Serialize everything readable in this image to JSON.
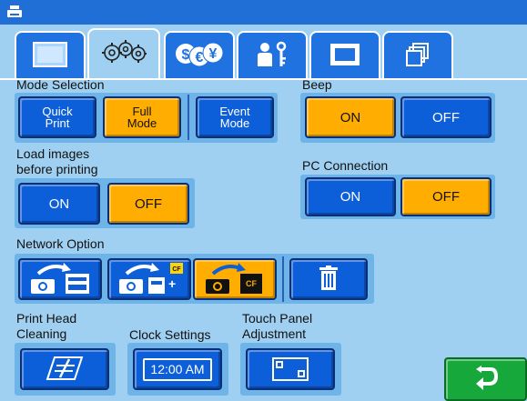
{
  "tabs": [
    {
      "id": "display",
      "icon": "blank-screen-icon",
      "active": false
    },
    {
      "id": "settings",
      "icon": "gears-icon",
      "active": true
    },
    {
      "id": "currency",
      "icon": "currency-icon",
      "active": false
    },
    {
      "id": "security",
      "icon": "person-key-icon",
      "active": false
    },
    {
      "id": "frame",
      "icon": "frame-icon",
      "active": false
    },
    {
      "id": "layers",
      "icon": "layers-icon",
      "active": false
    }
  ],
  "mode_selection": {
    "label": "Mode Selection",
    "quick_print": "Quick\nPrint",
    "full_mode": "Full\nMode",
    "event_mode": "Event\nMode",
    "selected": "full_mode"
  },
  "beep": {
    "label": "Beep",
    "on": "ON",
    "off": "OFF",
    "selected": "on"
  },
  "load_images": {
    "label": "Load images\nbefore printing",
    "on": "ON",
    "off": "OFF",
    "selected": "off"
  },
  "pc_connection": {
    "label": "PC Connection",
    "on": "ON",
    "off": "OFF",
    "selected": "off"
  },
  "network_option": {
    "label": "Network Option",
    "buttons": [
      {
        "name": "camera-to-printer",
        "selected": false
      },
      {
        "name": "camera-to-cf-printer",
        "selected": false
      },
      {
        "name": "camera-to-cf",
        "selected": true,
        "cf_text": "CF"
      },
      {
        "name": "trash",
        "selected": false
      }
    ],
    "cf_badge": "CF"
  },
  "print_head_cleaning": {
    "label": "Print Head\nCleaning"
  },
  "clock_settings": {
    "label": "Clock Settings",
    "time": "12:00 AM"
  },
  "touch_panel": {
    "label": "Touch Panel\nAdjustment"
  },
  "colors": {
    "blue_button": "#0d5fd9",
    "selected_button": "#ffad00",
    "background": "#9fd0f2",
    "back_button": "#16a83a"
  }
}
